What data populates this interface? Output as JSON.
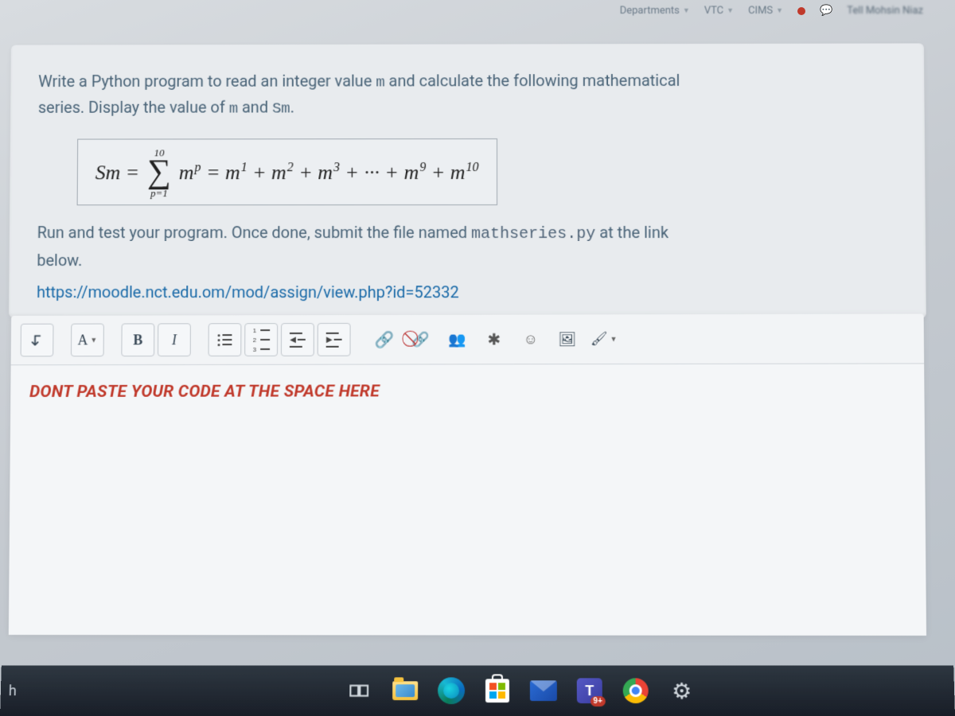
{
  "browser": {
    "tabs": [
      {
        "label": "Departments"
      },
      {
        "label": "VTC"
      },
      {
        "label": "CIMS"
      }
    ],
    "right_label": "Tell Mohsin Niaz"
  },
  "question": {
    "line1_a": "Write a Python program to read an integer value ",
    "line1_var": "m",
    "line1_b": "  and calculate the following mathematical",
    "line2_a": "series. Display the value of ",
    "line2_var1": "m",
    "line2_mid": "  and ",
    "line2_var2": "Sm",
    "line2_end": ".",
    "formula": {
      "lhs": "Sm =",
      "sigma_top": "10",
      "sigma_bottom": "p=1",
      "body_prefix": "m",
      "body_sup": "p",
      "eq": " = m",
      "s1": "1",
      "plus1": " + m",
      "s2": "2",
      "plus2": " + m",
      "s3": "3",
      "plus3": " + ··· + m",
      "s9": "9",
      "plus9": " + m",
      "s10": "10"
    },
    "run_a": "Run and test your program. Once done, submit the file named ",
    "run_file": "mathseries.py",
    "run_b": " at the link",
    "run_c": "below.",
    "link": "https://moodle.nct.edu.om/mod/assign/view.php?id=52332"
  },
  "toolbar": {
    "expand": "↴",
    "font_color": "A",
    "bold": "B",
    "italic": "I"
  },
  "editor": {
    "placeholder": "DONT PASTE YOUR CODE AT THE SPACE HERE"
  },
  "taskbar": {
    "search_hint": "h",
    "teams_letter": "T",
    "teams_badge": "9+"
  }
}
